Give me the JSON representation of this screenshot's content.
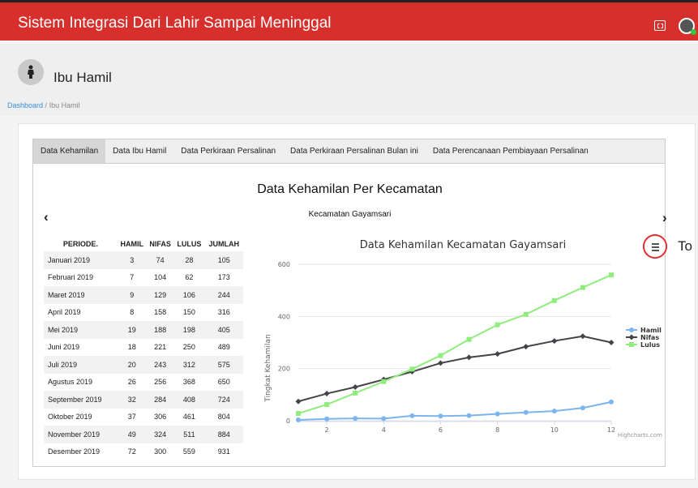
{
  "app": {
    "title": "Sistem Integrasi Dari Lahir Sampai Meninggal"
  },
  "page": {
    "title": "Ibu Hamil"
  },
  "breadcrumb": {
    "home": "Dashboard",
    "separator": "/",
    "current": "Ibu Hamil"
  },
  "tabs": [
    {
      "label": "Data Kehamilan",
      "active": true
    },
    {
      "label": "Data Ibu Hamil",
      "active": false
    },
    {
      "label": "Data Perkiraan Persalinan",
      "active": false
    },
    {
      "label": "Data Perkiraan Persalinan Bulan ini",
      "active": false
    },
    {
      "label": "Data Perencanaan Pembiayaan Persalinan",
      "active": false
    }
  ],
  "section": {
    "title": "Data Kehamilan Per Kecamatan",
    "subtitle": "Kecamatan Gayamsari",
    "prev": "‹",
    "next": "›"
  },
  "table": {
    "headers": [
      "PERIODE.",
      "HAMIL",
      "NIFAS",
      "LULUS",
      "JUMLAH"
    ],
    "rows": [
      [
        "Januari 2019",
        "3",
        "74",
        "28",
        "105"
      ],
      [
        "Februari 2019",
        "7",
        "104",
        "62",
        "173"
      ],
      [
        "Maret 2019",
        "9",
        "129",
        "106",
        "244"
      ],
      [
        "April 2019",
        "8",
        "158",
        "150",
        "316"
      ],
      [
        "Mei 2019",
        "19",
        "188",
        "198",
        "405"
      ],
      [
        "Juni 2019",
        "18",
        "221",
        "250",
        "489"
      ],
      [
        "Juli 2019",
        "20",
        "243",
        "312",
        "575"
      ],
      [
        "Agustus 2019",
        "26",
        "256",
        "368",
        "650"
      ],
      [
        "September 2019",
        "32",
        "284",
        "408",
        "724"
      ],
      [
        "Oktober 2019",
        "37",
        "306",
        "461",
        "804"
      ],
      [
        "November 2019",
        "49",
        "324",
        "511",
        "884"
      ],
      [
        "Desember 2019",
        "72",
        "300",
        "559",
        "931"
      ]
    ]
  },
  "chart_menu": {
    "tooltip": "To"
  },
  "chart_data": {
    "type": "line",
    "title": "Data Kehamilan Kecamatan Gayamsari",
    "xlabel": "",
    "ylabel": "Tingkat Kehamilan",
    "x": [
      1,
      2,
      3,
      4,
      5,
      6,
      7,
      8,
      9,
      10,
      11,
      12
    ],
    "xticks": [
      2,
      4,
      6,
      8,
      10,
      12
    ],
    "yticks": [
      0,
      200,
      400,
      600
    ],
    "xlim": [
      1,
      12
    ],
    "ylim": [
      0,
      600
    ],
    "grid": true,
    "legend": "right",
    "credits": "Highcharts.com",
    "series": [
      {
        "name": "Hamil",
        "color": "#7cb5ec",
        "marker": "circle",
        "values": [
          3,
          7,
          9,
          8,
          19,
          18,
          20,
          26,
          32,
          37,
          49,
          72
        ]
      },
      {
        "name": "Nifas",
        "color": "#434348",
        "marker": "diamond",
        "values": [
          74,
          104,
          129,
          158,
          188,
          221,
          243,
          256,
          284,
          306,
          324,
          300
        ]
      },
      {
        "name": "Lulus",
        "color": "#90ed7d",
        "marker": "square",
        "values": [
          28,
          62,
          106,
          150,
          198,
          250,
          312,
          368,
          408,
          461,
          511,
          559
        ]
      }
    ]
  }
}
